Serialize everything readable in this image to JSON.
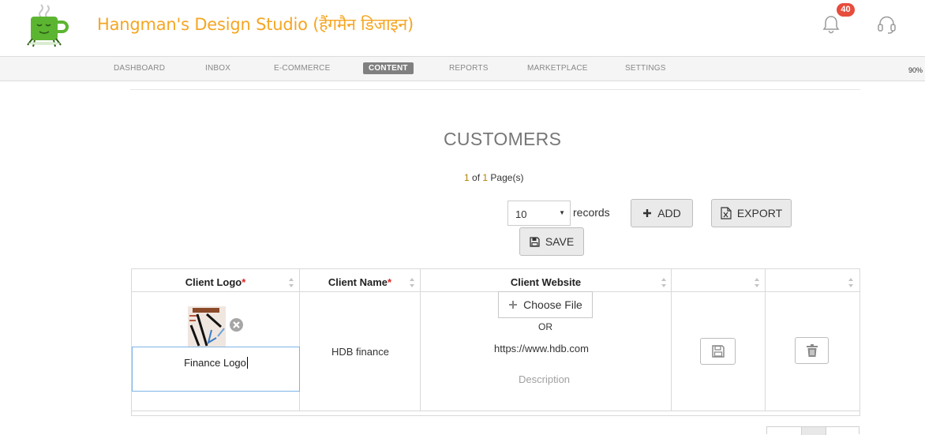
{
  "header": {
    "title": "Hangman's Design Studio (हैंगमैन डिजाइन)",
    "notification_count": "40",
    "logo_icon": "mug-logo-icon",
    "accent_color": "#f5a623",
    "badge_color": "#e74c3c"
  },
  "nav": {
    "items": [
      {
        "label": "DASHBOARD"
      },
      {
        "label": "INBOX"
      },
      {
        "label": "E-COMMERCE"
      },
      {
        "label": "CONTENT"
      },
      {
        "label": "REPORTS"
      },
      {
        "label": "MARKETPLACE"
      },
      {
        "label": "SETTINGS"
      }
    ],
    "active": "CONTENT",
    "zoom": "90%"
  },
  "page": {
    "heading": "CUSTOMERS",
    "pager": {
      "current": "1",
      "of_label": "of",
      "total": "1",
      "suffix": "Page(s)"
    }
  },
  "toolbar": {
    "records_value": "10",
    "records_label": "records",
    "add_label": "ADD",
    "export_label": "EXPORT",
    "save_label": "SAVE"
  },
  "table": {
    "columns": [
      {
        "label": "Client Logo",
        "required": "*"
      },
      {
        "label": "Client Name",
        "required": "*"
      },
      {
        "label": "Client Website",
        "required": ""
      },
      {
        "label": "",
        "required": ""
      },
      {
        "label": "",
        "required": ""
      }
    ],
    "rows": [
      {
        "logo_alt_input": "Finance Logo",
        "client_name": "HDB finance",
        "choose_file_label": "Choose File",
        "or_label": "OR",
        "website": "https://www.hdb.com",
        "description_placeholder": "Description"
      }
    ]
  }
}
